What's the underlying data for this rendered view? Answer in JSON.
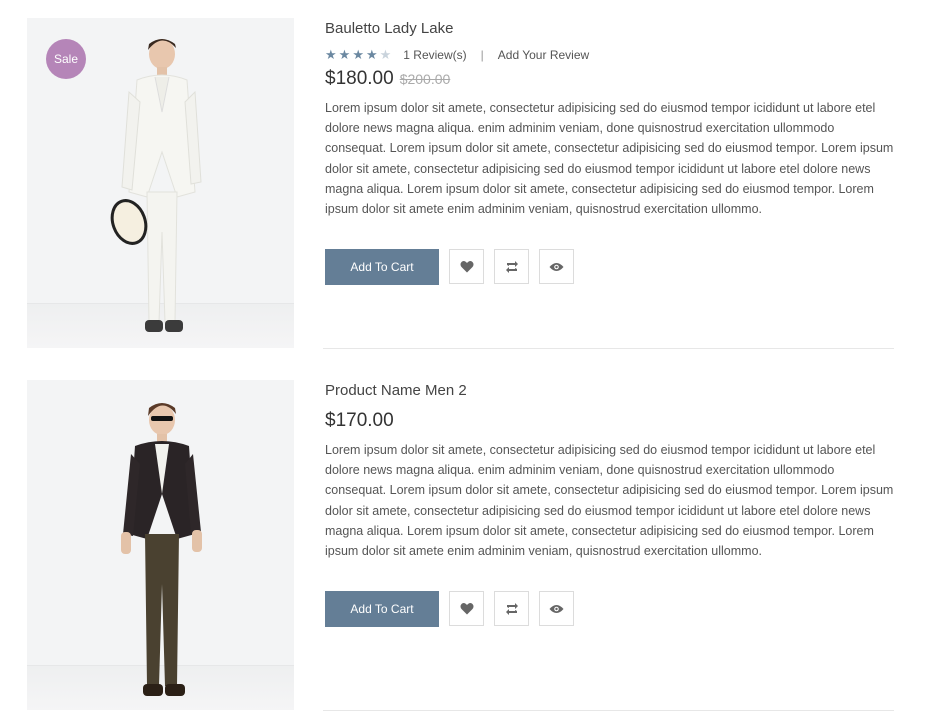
{
  "products": [
    {
      "badge": "Sale",
      "title": "Bauletto Lady Lake",
      "rating": 4,
      "reviews_label": "1 Review(s)",
      "separator": "|",
      "add_review_label": "Add Your Review",
      "price": "$180.00",
      "old_price": "$200.00",
      "description": "Lorem ipsum dolor sit amete, consectetur adipisicing sed do eiusmod tempor icididunt ut labore etel dolore news magna aliqua. enim adminim veniam, done quisnostrud exercitation ullommodo consequat. Lorem ipsum dolor sit amete, consectetur adipisicing sed do eiusmod tempor. Lorem ipsum dolor sit amete, consectetur adipisicing sed do eiusmod tempor icididunt ut labore etel dolore news magna aliqua. Lorem ipsum dolor sit amete, consectetur adipisicing sed do eiusmod tempor. Lorem ipsum dolor sit amete enim adminim veniam, quisnostrud exercitation ullommo.",
      "add_to_cart": "Add To Cart"
    },
    {
      "title": "Product Name Men 2",
      "price": "$170.00",
      "description": "Lorem ipsum dolor sit amete, consectetur adipisicing sed do eiusmod tempor icididunt ut labore etel dolore news magna aliqua. enim adminim veniam, done quisnostrud exercitation ullommodo consequat. Lorem ipsum dolor sit amete, consectetur adipisicing sed do eiusmod tempor. Lorem ipsum dolor sit amete, consectetur adipisicing sed do eiusmod tempor icididunt ut labore etel dolore news magna aliqua. Lorem ipsum dolor sit amete, consectetur adipisicing sed do eiusmod tempor. Lorem ipsum dolor sit amete enim adminim veniam, quisnostrud exercitation ullommo.",
      "add_to_cart": "Add To Cart"
    }
  ],
  "icons": [
    "heart-icon",
    "compare-icon",
    "eye-icon"
  ],
  "colors": {
    "accent": "#647e96",
    "sale_badge": "#b585b8",
    "star": "#6b88a1"
  }
}
